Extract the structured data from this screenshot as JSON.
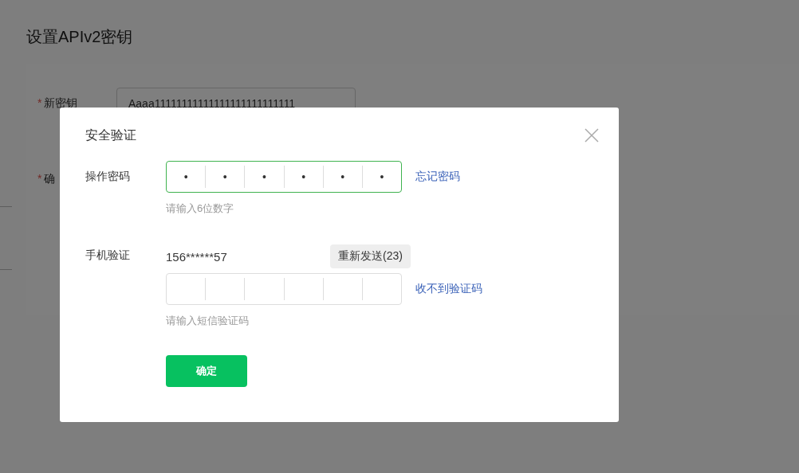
{
  "page": {
    "title": "设置APIv2密钥",
    "form": [
      {
        "mark": "*",
        "label": "新密钥",
        "value": "Aaaa11111111111111111111111111"
      },
      {
        "mark": "*",
        "label": "确"
      }
    ]
  },
  "dialog": {
    "title": "安全验证",
    "password": {
      "label": "操作密码",
      "focused": true,
      "digits": [
        "•",
        "•",
        "•",
        "•",
        "•",
        "•"
      ],
      "hint": "请输入6位数字",
      "link": "忘记密码"
    },
    "phone": {
      "label": "手机验证",
      "number": "156******57",
      "resend": "重新发送(23)",
      "focused": false,
      "hint": "请输入短信验证码",
      "link": "收不到验证码"
    },
    "confirm": "确定"
  }
}
